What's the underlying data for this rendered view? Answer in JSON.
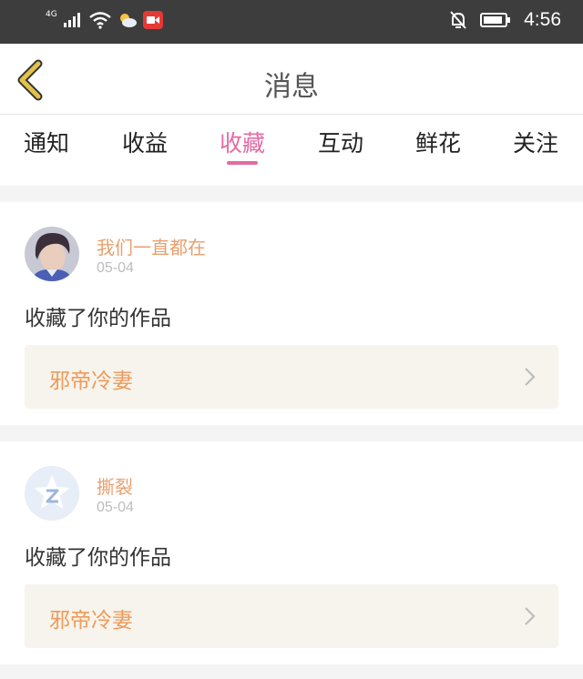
{
  "status_bar": {
    "network": "4G",
    "time": "4:56"
  },
  "header": {
    "title": "消息"
  },
  "tabs": [
    {
      "label": "通知"
    },
    {
      "label": "收益"
    },
    {
      "label": "收藏"
    },
    {
      "label": "互动"
    },
    {
      "label": "鲜花"
    },
    {
      "label": "关注"
    }
  ],
  "active_tab": "收藏",
  "notifications": [
    {
      "user": "我们一直都在",
      "date": "05-04",
      "action": "收藏了你的作品",
      "work_title": "邪帝冷妻"
    },
    {
      "user": "撕裂",
      "date": "05-04",
      "action": "收藏了你的作品",
      "work_title": "邪帝冷妻"
    }
  ],
  "colors": {
    "accent": "#e56aa3",
    "username": "#e8a06e",
    "work_title": "#ef9a5a",
    "back_icon": "#e2c24a"
  }
}
